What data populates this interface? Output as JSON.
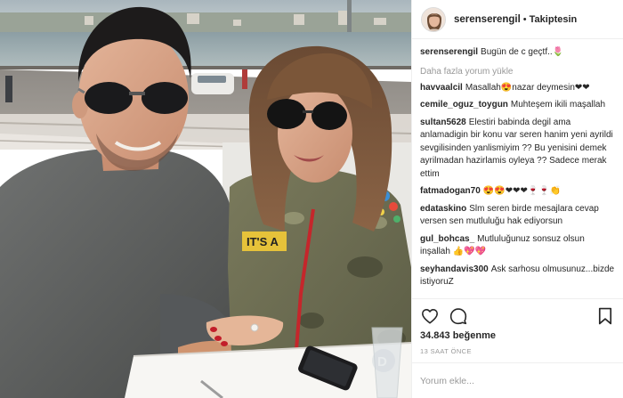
{
  "photo": {
    "alt": "Couple wearing sunglasses at a waterside table",
    "shirt_text": "IT'S A"
  },
  "header": {
    "username": "serenserengil",
    "separator": "•",
    "follow_status": "Takiptesin"
  },
  "caption": {
    "username": "serenserengil",
    "text": "Bugün de c geçtf..🌷"
  },
  "load_more_label": "Daha fazla yorum yükle",
  "comments": [
    {
      "username": "havvaalcil",
      "text": "Masallah😍nazar deymesin❤❤"
    },
    {
      "username": "cemile_oguz_toygun",
      "text": "Muhteşem ikili maşallah"
    },
    {
      "username": "sultan5628",
      "text": "Elestiri babinda degil ama anlamadigin bir konu var seren hanim yeni ayrildi sevgilisinden yanlismiyim ?? Bu yenisini demek ayrilmadan hazirlamis oyleya ?? Sadece merak ettim"
    },
    {
      "username": "fatmadogan70",
      "text": "😍😍❤❤❤🍷🍷👏"
    },
    {
      "username": "edataskino",
      "text": "Slm seren birde mesajlara cevap versen sen mutluluğu hak ediyorsun"
    },
    {
      "username": "gul_bohcas_",
      "text": "Mutluluğunuz sonsuz olsun inşallah 👍💖💖"
    },
    {
      "username": "seyhandavis300",
      "text": "Ask sarhosu olmusunuz...bizde istiyoruZ"
    }
  ],
  "actions": {
    "like_icon": "heart-icon",
    "comment_icon": "comment-icon",
    "save_icon": "bookmark-icon"
  },
  "likes_text": "34.843 beğenme",
  "timestamp": "13 SAAT ÖNCE",
  "add_comment_placeholder": "Yorum ekle..."
}
